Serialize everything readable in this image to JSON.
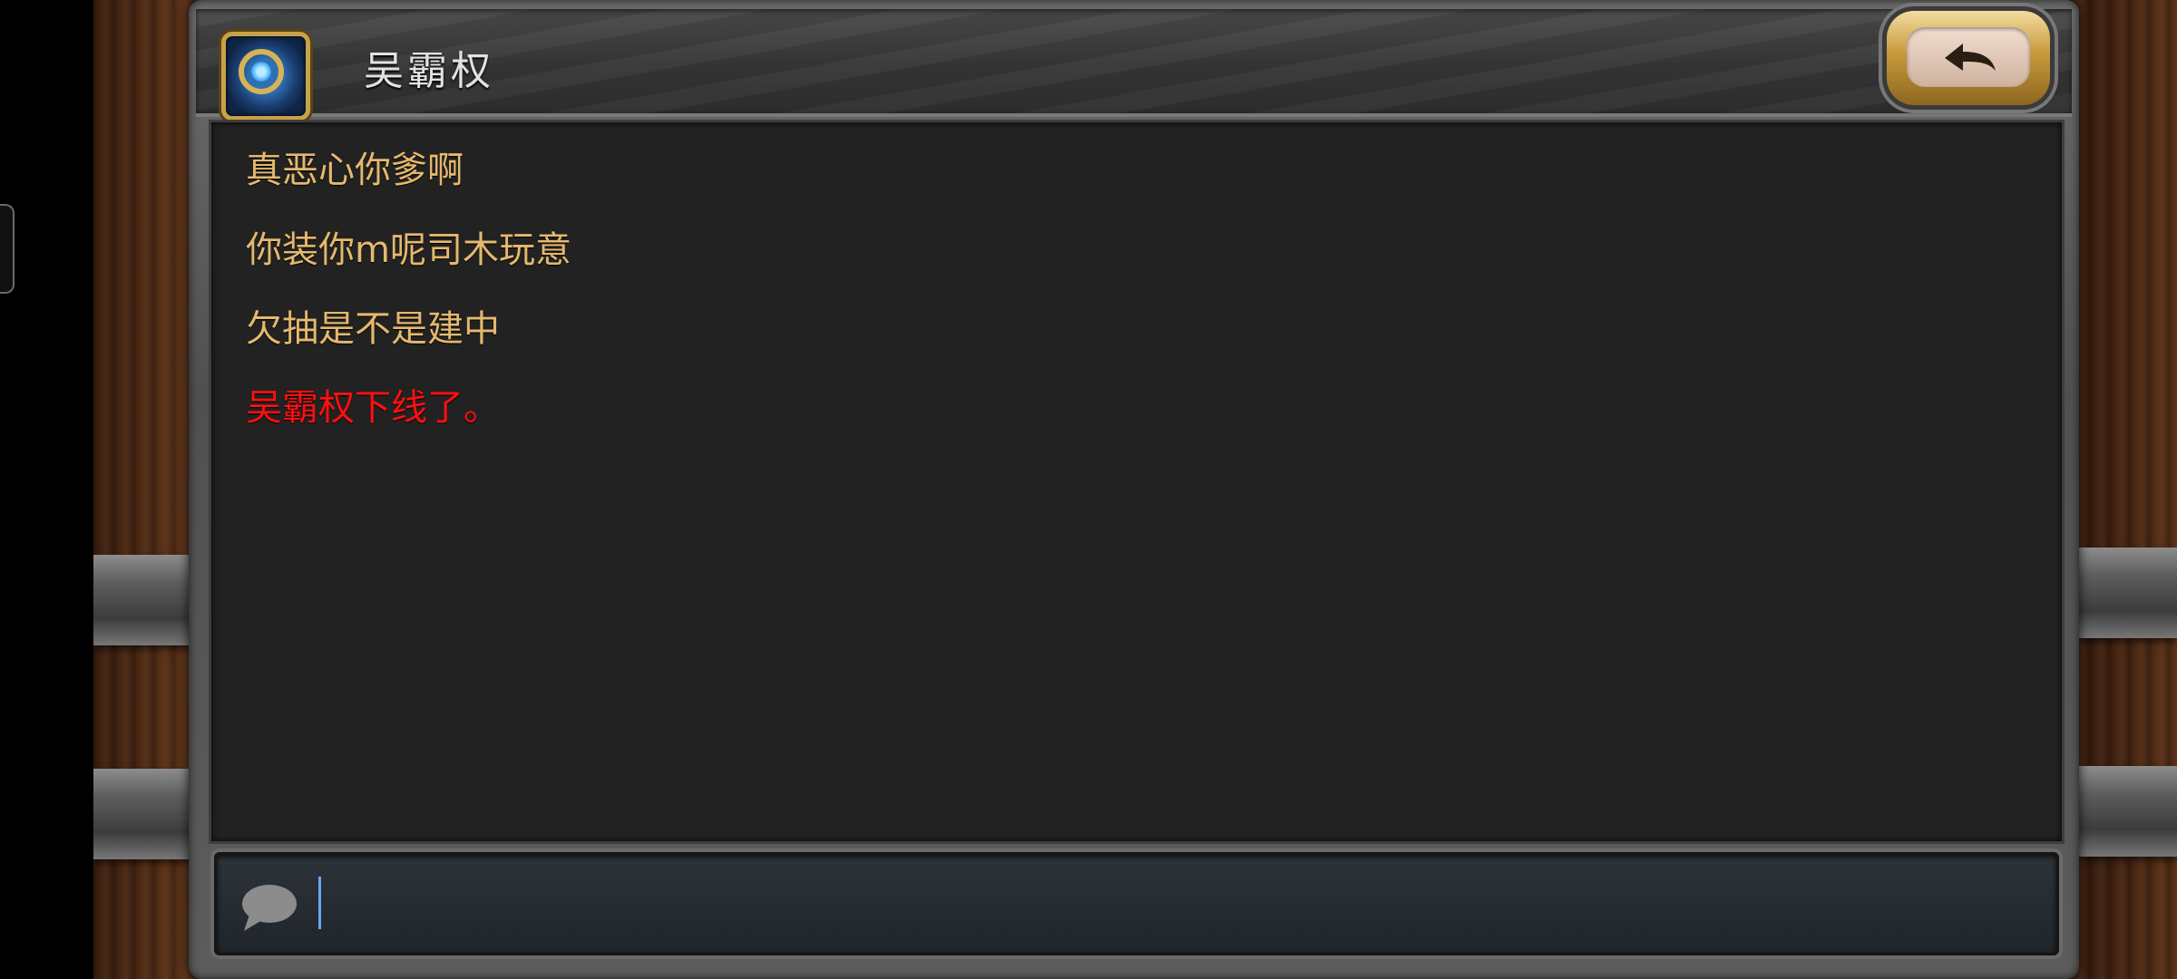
{
  "header": {
    "title": "吴霸权",
    "logo_icon": "hearthstone-logo-icon",
    "back_icon": "back-arrow-icon"
  },
  "messages": [
    {
      "text": "真恶心你爹啊",
      "type": "chat"
    },
    {
      "text": "你装你m呢司木玩意",
      "type": "chat"
    },
    {
      "text": "欠抽是不是建中",
      "type": "chat"
    },
    {
      "text": "吴霸权下线了。",
      "type": "system"
    }
  ],
  "input": {
    "value": "",
    "icon": "chat-bubble-icon"
  },
  "colors": {
    "chat_text": "#e5b86e",
    "system_text": "#ff1010",
    "chat_bg": "#222222"
  }
}
